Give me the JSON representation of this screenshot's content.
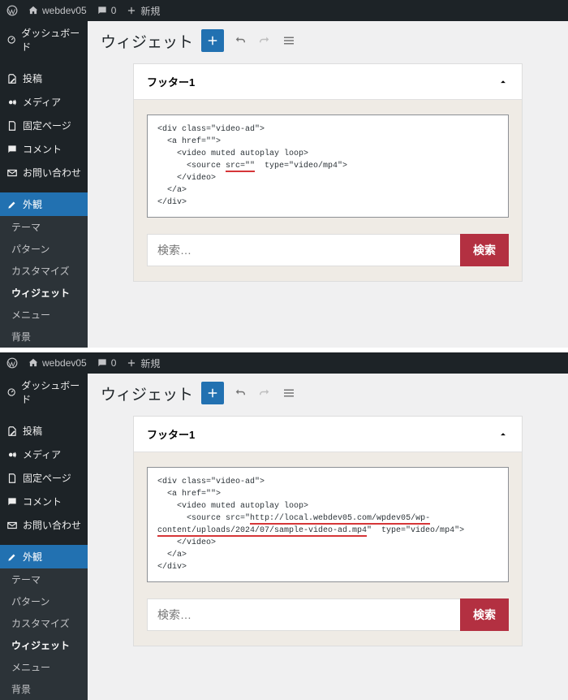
{
  "topbar": {
    "site_name": "webdev05",
    "comment_count": "0",
    "new_label": "新規"
  },
  "sidebar": {
    "dashboard": "ダッシュボード",
    "posts": "投稿",
    "media": "メディア",
    "pages": "固定ページ",
    "comments": "コメント",
    "contact": "お問い合わせ",
    "appearance": "外観",
    "submenu": {
      "theme": "テーマ",
      "patterns": "パターン",
      "customize": "カスタマイズ",
      "widgets": "ウィジェット",
      "menus": "メニュー",
      "background": "背景"
    }
  },
  "page": {
    "title": "ウィジェット"
  },
  "top": {
    "area_title": "フッター1",
    "code_lines": [
      "<div class=\"video-ad\">",
      "  <a href=\"\">",
      "    <video muted autoplay loop>",
      "      <source ",
      "src=\"\"",
      "  type=\"video/mp4\">",
      "    </video>",
      "  </a>",
      "</div>"
    ],
    "search_placeholder": "検索…",
    "search_button": "検索"
  },
  "bottom": {
    "area_title": "フッター1",
    "code_lines": [
      "<div class=\"video-ad\">",
      "  <a href=\"\">",
      "    <video muted autoplay loop>",
      "      <source src=\"",
      "http://local.webdev05.com/wpdev05/wp-",
      "content/uploads/2024/07/sample-video-ad.mp4",
      "\"  type=\"video/mp4\">",
      "    </video>",
      "  </a>",
      "</div>"
    ],
    "search_placeholder": "検索…",
    "search_button": "検索"
  }
}
